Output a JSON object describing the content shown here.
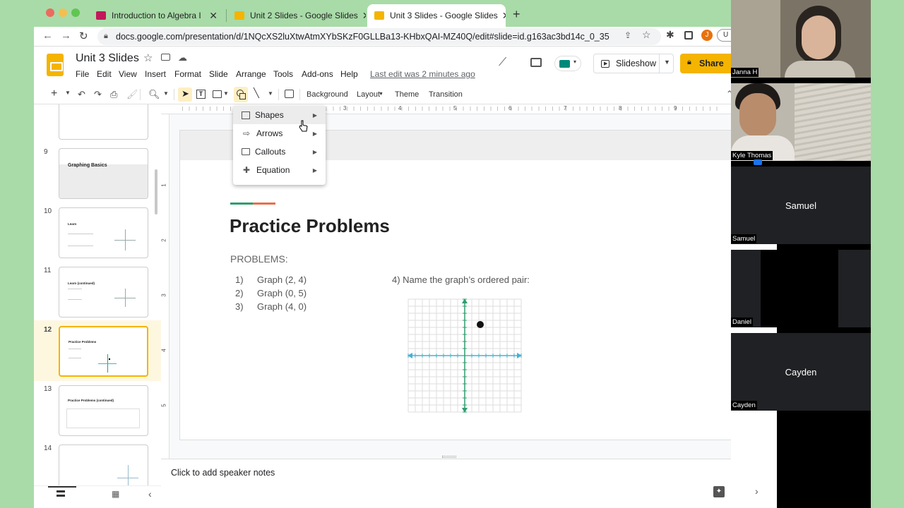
{
  "browser": {
    "tabs": [
      {
        "title": "Introduction to Algebra I",
        "color": "#c2185b"
      },
      {
        "title": "Unit 2 Slides - Google Slides",
        "color": "#f4b400"
      },
      {
        "title": "Unit 3 Slides - Google Slides",
        "color": "#f4b400",
        "active": true
      }
    ],
    "new_tab": "+",
    "url": "docs.google.com/presentation/d/1NQcXS2luXtwAtmXYbSKzF0GLLBa13-KHbxQAI-MZ40Q/edit#slide=id.g163ac3bd14c_0_35",
    "profile_initial": "J",
    "profile2": "U"
  },
  "doc": {
    "title": "Unit 3 Slides",
    "menus": [
      "File",
      "Edit",
      "View",
      "Insert",
      "Format",
      "Slide",
      "Arrange",
      "Tools",
      "Add-ons",
      "Help"
    ],
    "last_edit": "Last edit was 2 minutes ago",
    "slideshow": "Slideshow",
    "share": "Share"
  },
  "toolbar": {
    "background": "Background",
    "layout": "Layout",
    "theme": "Theme",
    "transition": "Transition"
  },
  "ruler_numbers": [
    "1",
    "2",
    "3",
    "4",
    "5",
    "6",
    "7",
    "8",
    "9"
  ],
  "vruler_numbers": [
    "1",
    "2",
    "3",
    "4",
    "5"
  ],
  "insert_menu": [
    {
      "label": "Shapes",
      "icon": "square-outline-icon"
    },
    {
      "label": "Arrows",
      "icon": "arrow-outline-icon"
    },
    {
      "label": "Callouts",
      "icon": "callout-outline-icon"
    },
    {
      "label": "Equation",
      "icon": "plus-outline-icon"
    }
  ],
  "filmstrip": [
    {
      "num": "",
      "title": ""
    },
    {
      "num": "9",
      "title": "Graphing Basics"
    },
    {
      "num": "10",
      "title": "Learn"
    },
    {
      "num": "11",
      "title": "Learn (continued)"
    },
    {
      "num": "12",
      "title": "Practice Problems",
      "selected": true
    },
    {
      "num": "13",
      "title": "Practice Problems (continued)"
    },
    {
      "num": "14",
      "title": ""
    }
  ],
  "slide": {
    "title": "Practice Problems",
    "subtitle": "PROBLEMS:",
    "problems": [
      {
        "n": "1)",
        "text": "Graph (2, 4)"
      },
      {
        "n": "2)",
        "text": "Graph (0, 5)"
      },
      {
        "n": "3)",
        "text": "Graph (4, 0)"
      }
    ],
    "question4": "4) Name the graph’s ordered pair:",
    "graph_point": {
      "x": 1,
      "y": 2
    },
    "accent_colors": [
      "#2e9e6e",
      "#e8704a"
    ]
  },
  "notes": "Click to add speaker notes",
  "participants": [
    {
      "name": "Janna H",
      "video": true
    },
    {
      "name": "Kyle Thomas",
      "video": true
    },
    {
      "name": "Samuel",
      "video": false
    },
    {
      "name": "Daniel",
      "video": false
    },
    {
      "name": "Cayden",
      "video": false
    }
  ]
}
